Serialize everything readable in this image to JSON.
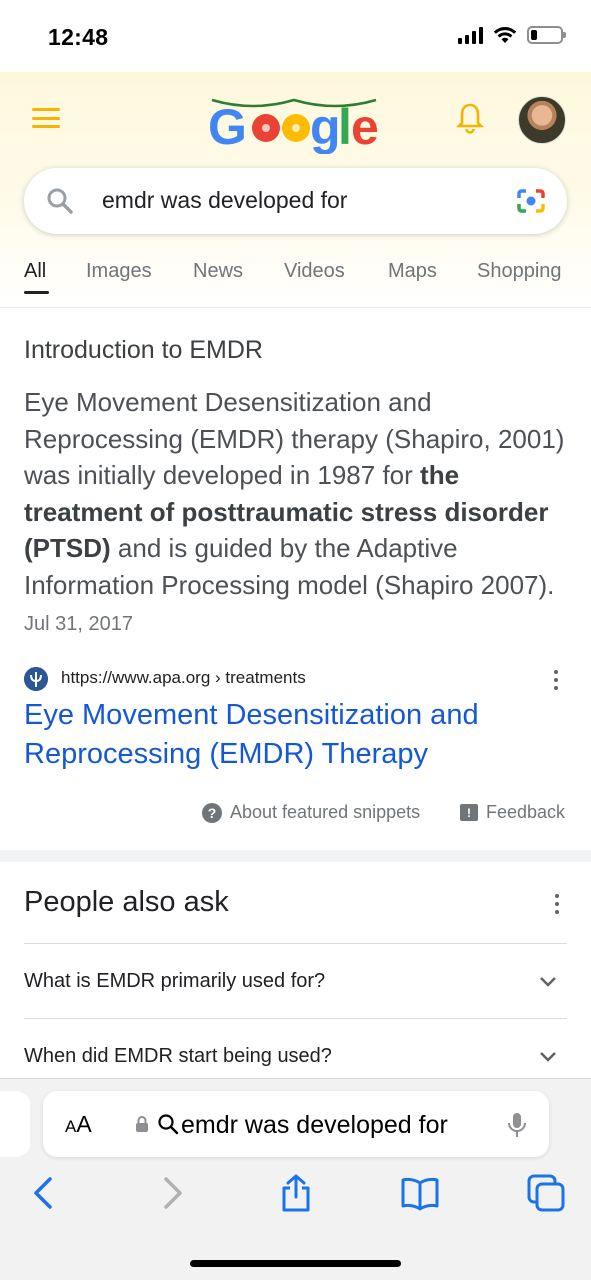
{
  "status_bar": {
    "time": "12:48"
  },
  "search": {
    "query": "emdr was developed for"
  },
  "tabs": [
    {
      "label": "All",
      "active": true
    },
    {
      "label": "Images",
      "active": false
    },
    {
      "label": "News",
      "active": false
    },
    {
      "label": "Videos",
      "active": false
    },
    {
      "label": "Maps",
      "active": false
    },
    {
      "label": "Shopping",
      "active": false
    }
  ],
  "snippet": {
    "title": "Introduction to EMDR",
    "body_before": "Eye Movement Desensitization and Reprocessing (EMDR) therapy (Shapiro, 2001) was initially developed in 1987 for ",
    "body_bold": "the treatment of posttraumatic stress disorder (PTSD)",
    "body_after": " and is guided by the Adaptive Information Processing model (Shapiro 2007).",
    "date": "Jul 31, 2017",
    "source_url": "https://www.apa.org › treatments",
    "link_title": "Eye Movement Desensitization and Reprocessing (EMDR) Therapy",
    "about_label": "About featured snippets",
    "feedback_label": "Feedback"
  },
  "people_also_ask": {
    "title": "People also ask",
    "questions": [
      "What is EMDR primarily used for?",
      "When did EMDR start being used?"
    ]
  },
  "safari": {
    "aa_label_big": "A",
    "aa_label_small": "A",
    "address_text": "emdr was developed for"
  },
  "colors": {
    "link": "#1558d6",
    "doodle_bg": "#fdf8dc",
    "accent_yellow": "#f4b400"
  }
}
